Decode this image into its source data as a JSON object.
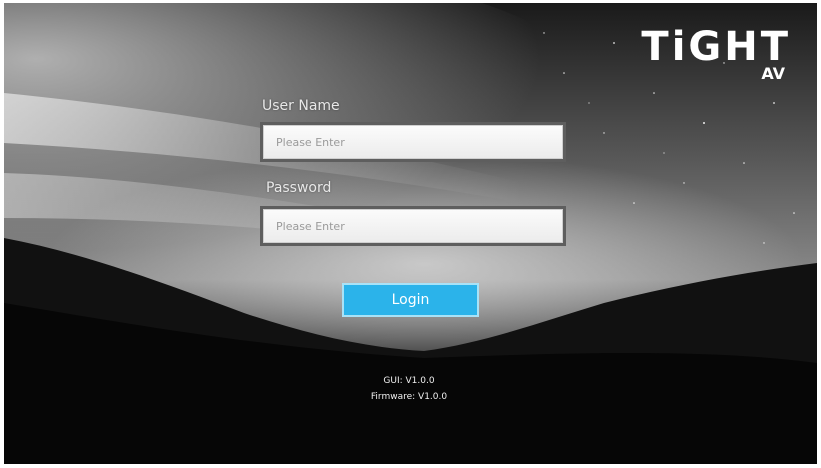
{
  "brand": {
    "logo_main": "TiGHT",
    "logo_sub": "AV"
  },
  "login_form": {
    "username_label": "User Name",
    "username_placeholder": "Please Enter",
    "password_label": "Password",
    "password_placeholder": "Please Enter",
    "login_label": "Login"
  },
  "version": {
    "gui": "GUI: V1.0.0",
    "firmware": "Firmware: V1.0.0"
  },
  "colors": {
    "accent": "#2bb3ea"
  }
}
